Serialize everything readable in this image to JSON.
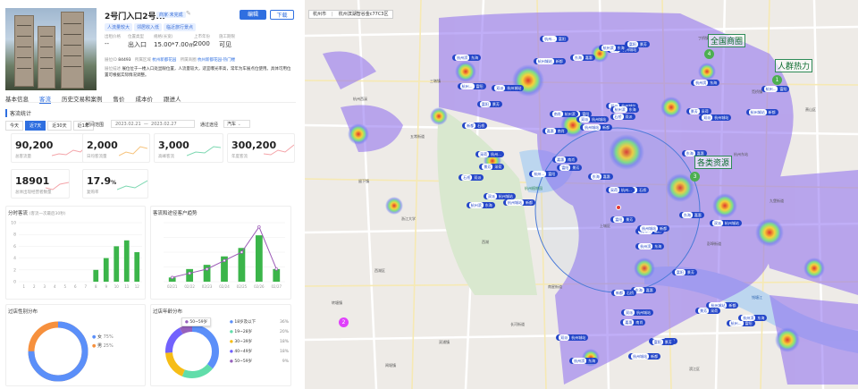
{
  "listing": {
    "title": "2号门入口2号...",
    "badge": "商家·未完成",
    "edit_label": "编辑",
    "download_label": "下载",
    "tags": [
      "人流量较大",
      "邻居收入低",
      "临近旅行景点"
    ],
    "fields": [
      {
        "label": "出租价格",
        "value": "--"
      },
      {
        "label": "位置类型",
        "value": "出入口"
      },
      {
        "label": "规格(长宽)",
        "value": "15.00*7.00㎡"
      },
      {
        "label": "上市年份",
        "value": "2000"
      },
      {
        "label": "施工期限",
        "value": "可见"
      }
    ],
    "code_label": "展位ID",
    "code": "84493",
    "area_label": "所属区域",
    "area": "杭州新都花园",
    "sub_label": "所属商圈",
    "sub": "杭州新都花园-热门楼",
    "desc_label": "展位描述",
    "desc": "展位位于一楼入口处显眼位置，人流量较大，适宜曝光率高，常年为车展点位使用。具体可用位置可根据实际情况调整。"
  },
  "tabs": [
    "基本信息",
    "客流",
    "历史交易和案例",
    "售价",
    "成本价",
    "跟进人"
  ],
  "traffic": {
    "title": "客流统计",
    "periods": [
      "今天",
      "近7天",
      "近30天",
      "近1年"
    ],
    "range_label": "时间范围",
    "start": "2023.02.21",
    "sep": "—",
    "end": "2023.02.27",
    "mode_label": "通过途径",
    "mode": "汽车"
  },
  "stats": [
    {
      "value": "90,200",
      "label": "总客流量"
    },
    {
      "value": "2,000",
      "label": "日均客流量"
    },
    {
      "value": "3,000",
      "label": "高峰客流"
    },
    {
      "value": "300,200",
      "label": "年度客流"
    },
    {
      "value": "18901",
      "label": "总体出现经营者数量"
    },
    {
      "value": "17.9",
      "unit": "%",
      "label": "复购率"
    }
  ],
  "bar_panel": {
    "title": "分时客流",
    "subtitle": "(客流一次最后30秒)"
  },
  "combo_panel": {
    "title": "客流和途径客户趋势"
  },
  "gender_panel": {
    "title": "过店性别分布",
    "items": [
      {
        "label": "女",
        "pct": "75%",
        "color": "#5b8ff9"
      },
      {
        "label": "男",
        "pct": "25%",
        "color": "#f6903d"
      }
    ]
  },
  "age_panel": {
    "title": "过店年龄分布",
    "selected": "50~59岁",
    "items": [
      {
        "label": "18岁及以下",
        "pct": "36%",
        "color": "#5b8ff9"
      },
      {
        "label": "19~28岁",
        "pct": "20%",
        "color": "#61ddaa"
      },
      {
        "label": "30~39岁",
        "pct": "18%",
        "color": "#f6bd16"
      },
      {
        "label": "40~49岁",
        "pct": "18%",
        "color": "#7262fd"
      },
      {
        "label": "50~59岁",
        "pct": "9%",
        "color": "#9661bc"
      }
    ]
  },
  "chart_data": [
    {
      "type": "bar",
      "title": "分时客流",
      "categories": [
        "1",
        "2",
        "3",
        "4",
        "5",
        "6",
        "7",
        "8",
        "9",
        "10",
        "11",
        "12"
      ],
      "values": [
        0,
        0,
        0,
        0,
        0,
        0,
        0,
        2,
        4,
        6,
        7,
        5
      ],
      "ylim": [
        0,
        10
      ],
      "yticks": [
        "0",
        "2",
        "4",
        "6",
        "8",
        "10"
      ]
    },
    {
      "type": "bar",
      "title": "客流和途径客户趋势",
      "categories": [
        "02/21",
        "02/22",
        "02/23",
        "02/24",
        "02/25",
        "02/26",
        "02/27"
      ],
      "values": [
        1,
        3,
        4,
        6,
        8,
        11,
        3
      ],
      "line": [
        1,
        2,
        3,
        5,
        7,
        13,
        3
      ],
      "ylim": [
        0,
        14
      ]
    }
  ],
  "map": {
    "city": "杭州市",
    "search": "杭州滨湖智谷金c77C3区",
    "labels": [
      "全国商圈",
      "人群热力",
      "各类资源"
    ],
    "clusters": [
      {
        "n": "4",
        "color": "#4caf50"
      },
      {
        "n": "1",
        "color": "#4caf50"
      },
      {
        "n": "3",
        "color": "#4caf50"
      },
      {
        "n": "2",
        "color": "#e040fb"
      }
    ],
    "places": [
      "三墩镇",
      "杭州西溪",
      "五常街道",
      "杭州植物园",
      "西湖",
      "浙江大学",
      "西湖区",
      "转塘镇",
      "上城区",
      "南星街道",
      "闻堰镇",
      "杭州东站",
      "九堡街道",
      "钱塘江",
      "双浦镇",
      "留下镇",
      "萧山区",
      "滨江区",
      "长河街道",
      "丁桥镇",
      "笕桥镇",
      "彭埠街道"
    ],
    "pill_text": [
      "双派",
      "杭州...",
      "杭州滨",
      "杭州城站",
      "富阳",
      "东海",
      "新都",
      "景芳",
      "嘉惠",
      "石桥",
      "采荷",
      "南肖"
    ]
  }
}
